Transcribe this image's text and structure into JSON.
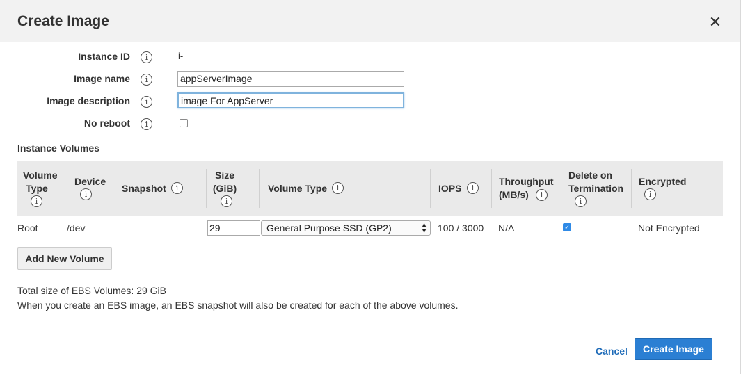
{
  "dialog": {
    "title": "Create Image",
    "close_glyph": "✕"
  },
  "form": {
    "instance_id": {
      "label": "Instance ID",
      "value": "i-"
    },
    "image_name": {
      "label": "Image name",
      "value": "appServerImage"
    },
    "image_description": {
      "label": "Image description",
      "value": "image For AppServer"
    },
    "no_reboot": {
      "label": "No reboot",
      "checked": false
    }
  },
  "volumes": {
    "section_title": "Instance Volumes",
    "columns": {
      "volume_type_line1": "Volume",
      "volume_type_line2": "Type",
      "device": "Device",
      "snapshot": "Snapshot",
      "size_line1": "Size",
      "size_line2": "(GiB)",
      "ebs_volume_type": "Volume Type",
      "iops": "IOPS",
      "throughput_line1": "Throughput",
      "throughput_line2": "(MB/s)",
      "delete_line1": "Delete on",
      "delete_line2": "Termination",
      "encrypted": "Encrypted"
    },
    "rows": [
      {
        "volume_type": "Root",
        "device": "/dev",
        "snapshot": "",
        "size": "29",
        "ebs_volume_type": "General Purpose SSD (GP2)",
        "iops": "100 / 3000",
        "throughput": "N/A",
        "delete_on_termination": true,
        "encrypted": "Not Encrypted"
      }
    ],
    "add_button": "Add New Volume"
  },
  "notes": {
    "total_size": "Total size of EBS Volumes: 29 GiB",
    "snapshot_note": "When you create an EBS image, an EBS snapshot will also be created for each of the above volumes."
  },
  "footer": {
    "cancel": "Cancel",
    "create": "Create Image"
  },
  "info_glyph": "i",
  "colors": {
    "primary": "#2b7fd3",
    "link": "#1e6bb8",
    "header_bg": "#f2f2f2",
    "table_header_bg": "#eaeaea",
    "checkbox_checked": "#2f8ae6"
  }
}
